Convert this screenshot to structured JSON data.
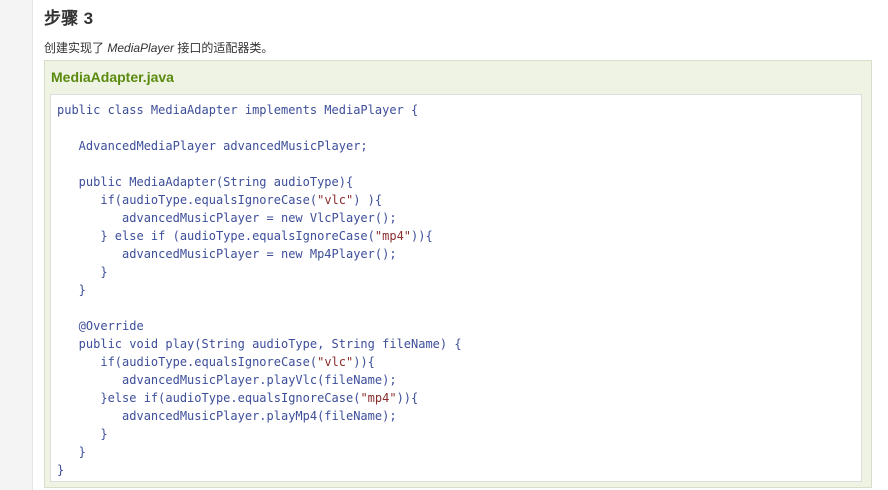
{
  "step": {
    "title": "步骤 3",
    "desc_prefix": "创建实现了 ",
    "desc_interface": "MediaPlayer",
    "desc_suffix": " 接口的适配器类。"
  },
  "file": {
    "name": "MediaAdapter.java"
  },
  "code": {
    "lines": [
      [
        {
          "t": "public class MediaAdapter implements MediaPlayer {",
          "c": "plain"
        }
      ],
      [
        {
          "t": "",
          "c": "plain"
        }
      ],
      [
        {
          "t": "   AdvancedMediaPlayer advancedMusicPlayer;",
          "c": "plain"
        }
      ],
      [
        {
          "t": "",
          "c": "plain"
        }
      ],
      [
        {
          "t": "   public MediaAdapter(String audioType){",
          "c": "plain"
        }
      ],
      [
        {
          "t": "      if(audioType.equalsIgnoreCase(",
          "c": "plain"
        },
        {
          "t": "\"vlc\"",
          "c": "str"
        },
        {
          "t": ") ){",
          "c": "plain"
        }
      ],
      [
        {
          "t": "         advancedMusicPlayer = new VlcPlayer();",
          "c": "plain"
        }
      ],
      [
        {
          "t": "      } else if (audioType.equalsIgnoreCase(",
          "c": "plain"
        },
        {
          "t": "\"mp4\"",
          "c": "str"
        },
        {
          "t": ")){",
          "c": "plain"
        }
      ],
      [
        {
          "t": "         advancedMusicPlayer = new Mp4Player();",
          "c": "plain"
        }
      ],
      [
        {
          "t": "      }",
          "c": "plain"
        }
      ],
      [
        {
          "t": "   }",
          "c": "plain"
        }
      ],
      [
        {
          "t": "",
          "c": "plain"
        }
      ],
      [
        {
          "t": "   @Override",
          "c": "plain"
        }
      ],
      [
        {
          "t": "   public void play(String audioType, String fileName) {",
          "c": "plain"
        }
      ],
      [
        {
          "t": "      if(audioType.equalsIgnoreCase(",
          "c": "plain"
        },
        {
          "t": "\"vlc\"",
          "c": "str"
        },
        {
          "t": ")){",
          "c": "plain"
        }
      ],
      [
        {
          "t": "         advancedMusicPlayer.playVlc(fileName);",
          "c": "plain"
        }
      ],
      [
        {
          "t": "      }else if(audioType.equalsIgnoreCase(",
          "c": "plain"
        },
        {
          "t": "\"mp4\"",
          "c": "str"
        },
        {
          "t": ")){",
          "c": "plain"
        }
      ],
      [
        {
          "t": "         advancedMusicPlayer.playMp4(fileName);",
          "c": "plain"
        }
      ],
      [
        {
          "t": "      }",
          "c": "plain"
        }
      ],
      [
        {
          "t": "   }",
          "c": "plain"
        }
      ],
      [
        {
          "t": "}",
          "c": "plain"
        }
      ]
    ]
  },
  "colors": {
    "code_text": "#3d4e9a",
    "string_literal": "#8a2e2e",
    "file_title": "#5a8a0e",
    "box_background": "#eef3e4"
  }
}
